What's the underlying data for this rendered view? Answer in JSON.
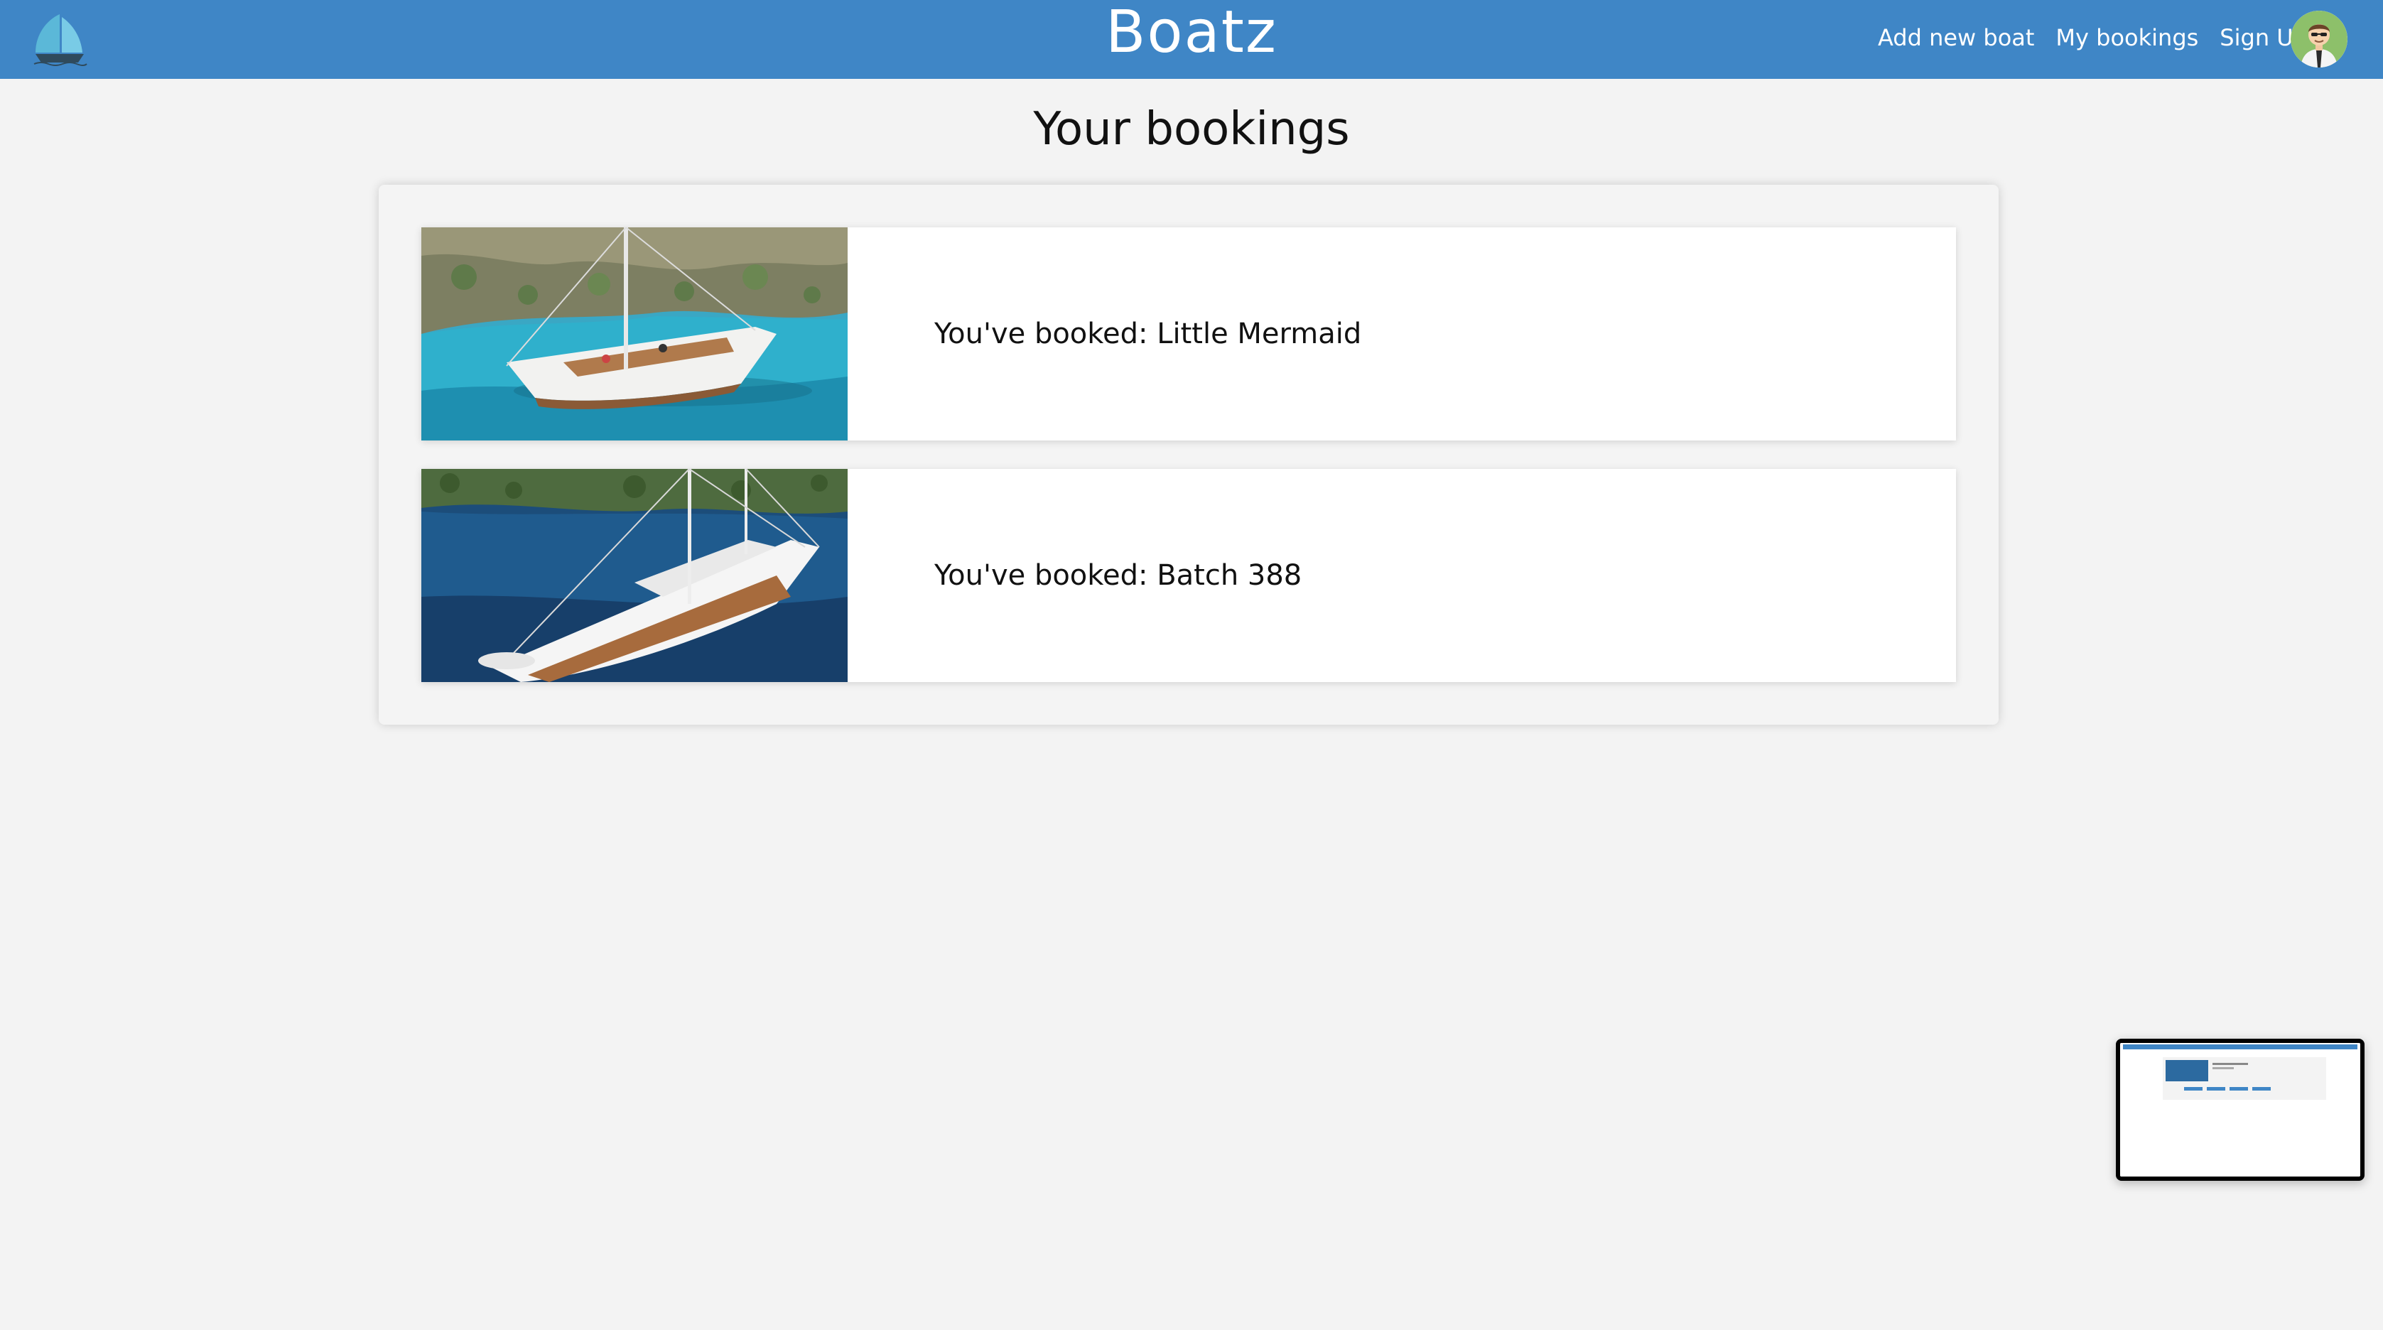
{
  "header": {
    "brand": "Boatz",
    "nav": {
      "add_boat": "Add new boat",
      "my_bookings": "My bookings",
      "sign_up": "Sign Up"
    },
    "brand_color": "#3f86c6",
    "logo_icon": "sailboat-icon",
    "avatar_icon": "user-avatar-icon"
  },
  "main": {
    "title": "Your bookings",
    "bookings": [
      {
        "text": "You've booked: Little Mermaid",
        "image": "boat-photo-little-mermaid"
      },
      {
        "text": "You've booked: Batch 388",
        "image": "boat-photo-batch-388"
      }
    ]
  },
  "preview": {
    "icon": "page-preview-thumbnail"
  }
}
